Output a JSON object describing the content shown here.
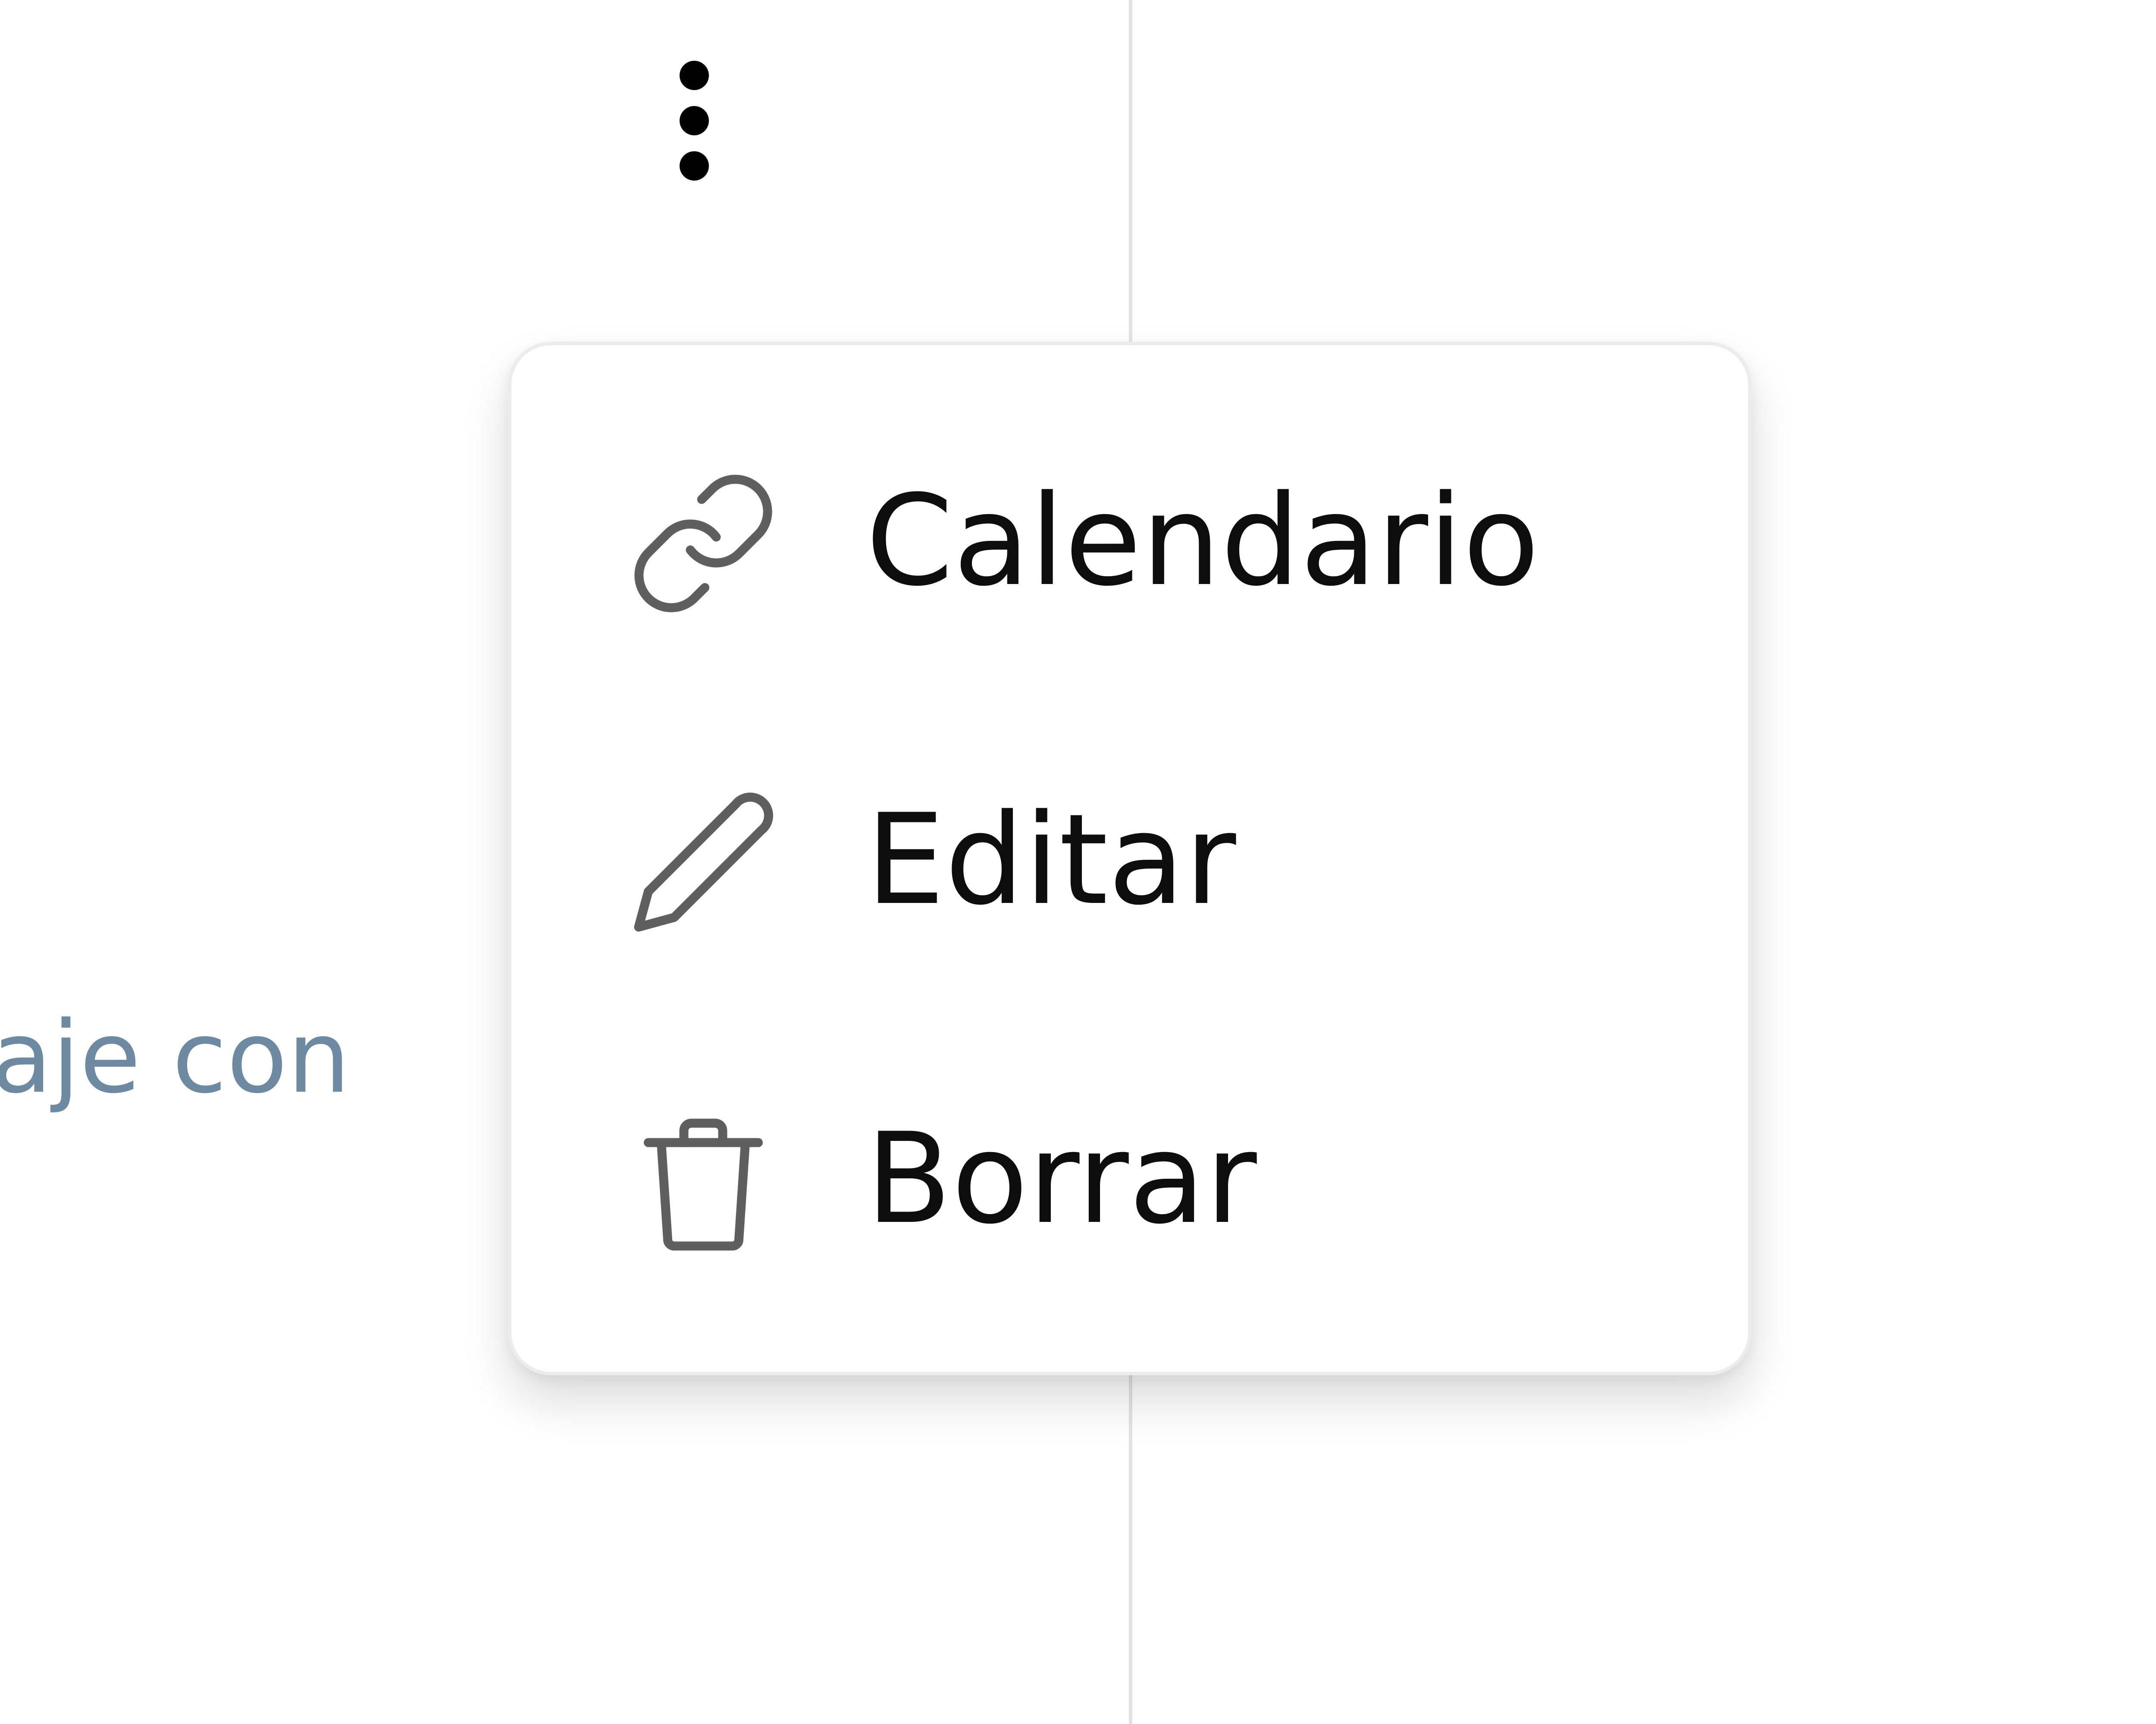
{
  "background_snippet": "aje con",
  "more_options": {
    "icon": "vertical-ellipsis-icon"
  },
  "menu": {
    "items": [
      {
        "label": "Calendario",
        "icon": "link-icon"
      },
      {
        "label": "Editar",
        "icon": "pencil-icon"
      },
      {
        "label": "Borrar",
        "icon": "trash-icon"
      }
    ]
  },
  "colors": {
    "menu_text": "#0d0d0d",
    "icon_stroke": "#5f5f5f",
    "snippet_text": "#6e8aa3",
    "divider": "#e3e3e3"
  }
}
